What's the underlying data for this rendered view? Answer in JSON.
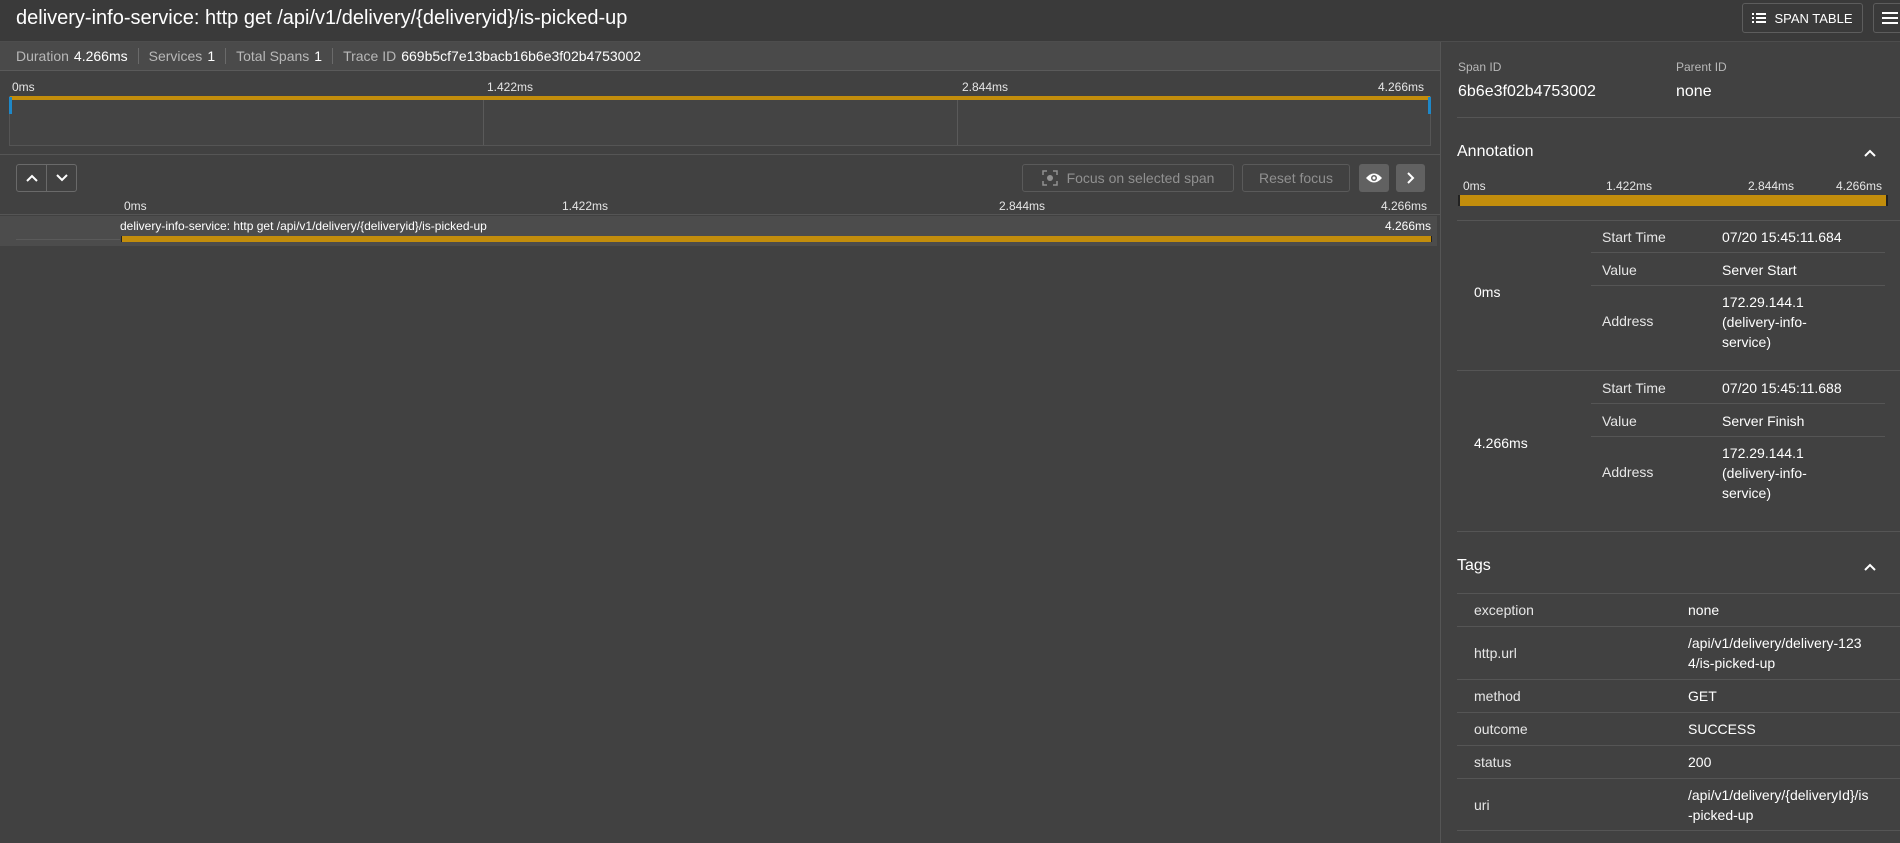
{
  "header": {
    "title": "delivery-info-service: http get /api/v1/delivery/{deliveryid}/is-picked-up",
    "span_table_label": "SPAN TABLE"
  },
  "summary": {
    "duration_label": "Duration",
    "duration_value": "4.266ms",
    "services_label": "Services",
    "services_value": "1",
    "total_spans_label": "Total Spans",
    "total_spans_value": "1",
    "trace_id_label": "Trace ID",
    "trace_id_value": "669b5cf7e13bacb16b6e3f02b4753002"
  },
  "minimap": {
    "ticks": [
      "0ms",
      "1.422ms",
      "2.844ms",
      "4.266ms"
    ]
  },
  "controls": {
    "focus_label": "Focus on selected span",
    "reset_label": "Reset focus"
  },
  "timeline": {
    "ticks": [
      "0ms",
      "1.422ms",
      "2.844ms",
      "4.266ms"
    ],
    "span": {
      "label": "delivery-info-service: http get /api/v1/delivery/{deliveryid}/is-picked-up",
      "duration": "4.266ms"
    }
  },
  "detail": {
    "span_id_label": "Span ID",
    "span_id_value": "6b6e3f02b4753002",
    "parent_id_label": "Parent ID",
    "parent_id_value": "none",
    "annotation_title": "Annotation",
    "annotation_ticks": [
      "0ms",
      "1.422ms",
      "2.844ms",
      "4.266ms"
    ],
    "annotations": [
      {
        "time": "0ms",
        "rows": [
          {
            "k": "Start Time",
            "v": "07/20 15:45:11.684"
          },
          {
            "k": "Value",
            "v": "Server Start"
          },
          {
            "k": "Address",
            "v": "172.29.144.1 (delivery-info-service)"
          }
        ]
      },
      {
        "time": "4.266ms",
        "rows": [
          {
            "k": "Start Time",
            "v": "07/20 15:45:11.688"
          },
          {
            "k": "Value",
            "v": "Server Finish"
          },
          {
            "k": "Address",
            "v": "172.29.144.1 (delivery-info-service)"
          }
        ]
      }
    ],
    "tags_title": "Tags",
    "tags": [
      {
        "k": "exception",
        "v": "none"
      },
      {
        "k": "http.url",
        "v": "/api/v1/delivery/delivery-1234/is-picked-up"
      },
      {
        "k": "method",
        "v": "GET"
      },
      {
        "k": "outcome",
        "v": "SUCCESS"
      },
      {
        "k": "status",
        "v": "200"
      },
      {
        "k": "uri",
        "v": "/api/v1/delivery/{deliveryId}/is-picked-up"
      }
    ]
  },
  "colors": {
    "span_bar": "#c28d0c",
    "handle": "#1e88c8",
    "background": "#414141"
  }
}
